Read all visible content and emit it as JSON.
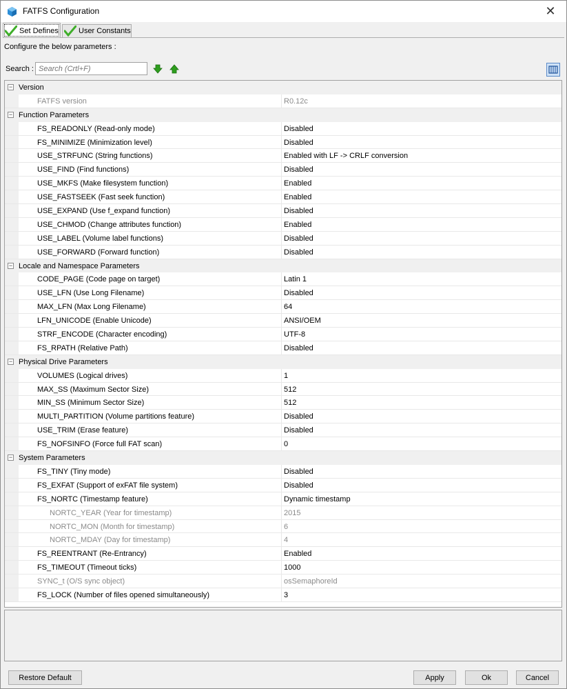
{
  "window": {
    "title": "FATFS Configuration"
  },
  "tabs": [
    {
      "label": "Set Defines"
    },
    {
      "label": "User Constants"
    }
  ],
  "description": "Configure the below parameters :",
  "search": {
    "label": "Search :",
    "placeholder": "Search (Crtl+F)"
  },
  "groups": [
    {
      "label": "Version",
      "params": [
        {
          "name": "FATFS version",
          "value": "R0.12c",
          "disabled": true
        }
      ]
    },
    {
      "label": "Function Parameters",
      "params": [
        {
          "name": "FS_READONLY (Read-only mode)",
          "value": "Disabled"
        },
        {
          "name": "FS_MINIMIZE (Minimization level)",
          "value": "Disabled"
        },
        {
          "name": "USE_STRFUNC (String functions)",
          "value": "Enabled with LF -> CRLF conversion"
        },
        {
          "name": "USE_FIND (Find functions)",
          "value": "Disabled"
        },
        {
          "name": "USE_MKFS (Make filesystem function)",
          "value": "Enabled"
        },
        {
          "name": "USE_FASTSEEK (Fast seek function)",
          "value": "Enabled"
        },
        {
          "name": "USE_EXPAND (Use f_expand function)",
          "value": "Disabled"
        },
        {
          "name": "USE_CHMOD (Change attributes function)",
          "value": "Enabled"
        },
        {
          "name": "USE_LABEL (Volume label functions)",
          "value": "Disabled"
        },
        {
          "name": "USE_FORWARD (Forward function)",
          "value": "Disabled"
        }
      ]
    },
    {
      "label": "Locale and Namespace Parameters",
      "params": [
        {
          "name": "CODE_PAGE (Code page on target)",
          "value": "Latin 1"
        },
        {
          "name": "USE_LFN (Use Long Filename)",
          "value": "Disabled"
        },
        {
          "name": "MAX_LFN (Max Long Filename)",
          "value": "64"
        },
        {
          "name": "LFN_UNICODE (Enable Unicode)",
          "value": "ANSI/OEM"
        },
        {
          "name": "STRF_ENCODE (Character encoding)",
          "value": "UTF-8"
        },
        {
          "name": "FS_RPATH (Relative Path)",
          "value": "Disabled"
        }
      ]
    },
    {
      "label": "Physical Drive Parameters",
      "params": [
        {
          "name": "VOLUMES (Logical drives)",
          "value": "1"
        },
        {
          "name": "MAX_SS (Maximum Sector Size)",
          "value": "512"
        },
        {
          "name": "MIN_SS (Minimum Sector Size)",
          "value": "512"
        },
        {
          "name": "MULTI_PARTITION (Volume partitions feature)",
          "value": "Disabled"
        },
        {
          "name": "USE_TRIM (Erase feature)",
          "value": "Disabled"
        },
        {
          "name": "FS_NOFSINFO (Force full FAT scan)",
          "value": "0"
        }
      ]
    },
    {
      "label": "System Parameters",
      "params": [
        {
          "name": "FS_TINY (Tiny mode)",
          "value": "Disabled"
        },
        {
          "name": "FS_EXFAT (Support of exFAT file system)",
          "value": "Disabled"
        },
        {
          "name": "FS_NORTC (Timestamp feature)",
          "value": "Dynamic timestamp"
        },
        {
          "name": "NORTC_YEAR (Year for timestamp)",
          "value": "2015",
          "disabled": true,
          "sub": true
        },
        {
          "name": "NORTC_MON (Month for timestamp)",
          "value": "6",
          "disabled": true,
          "sub": true
        },
        {
          "name": "NORTC_MDAY (Day for timestamp)",
          "value": "4",
          "disabled": true,
          "sub": true
        },
        {
          "name": "FS_REENTRANT (Re-Entrancy)",
          "value": "Enabled"
        },
        {
          "name": "FS_TIMEOUT (Timeout ticks)",
          "value": "1000"
        },
        {
          "name": "SYNC_t (O/S sync object)",
          "value": "osSemaphoreId",
          "disabled": true
        },
        {
          "name": "FS_LOCK (Number of files opened simultaneously)",
          "value": "3"
        }
      ]
    }
  ],
  "buttons": {
    "restore_default": "Restore Default",
    "apply": "Apply",
    "ok": "Ok",
    "cancel": "Cancel"
  },
  "colors": {
    "check_green": "#3fae2a",
    "arrow_green": "#2e9e1e",
    "accent_blue": "#1e90d8"
  }
}
